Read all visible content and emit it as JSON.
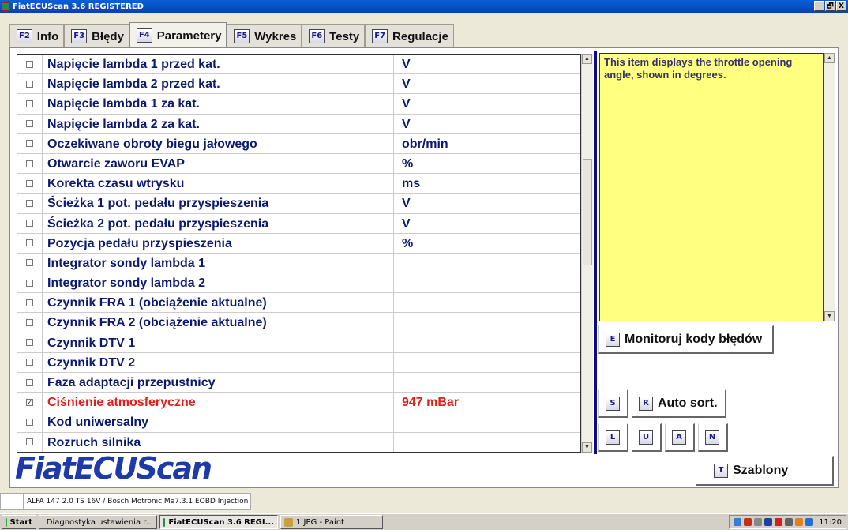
{
  "window": {
    "title": "FiatECUScan 3.6 REGISTERED",
    "controls": [
      "_",
      "🗗",
      "X"
    ]
  },
  "tabs": [
    {
      "key": "F2",
      "label": "Info"
    },
    {
      "key": "F3",
      "label": "Błędy"
    },
    {
      "key": "F4",
      "label": "Parametery",
      "active": true
    },
    {
      "key": "F5",
      "label": "Wykres"
    },
    {
      "key": "F6",
      "label": "Testy"
    },
    {
      "key": "F7",
      "label": "Regulacje"
    }
  ],
  "parameters": [
    {
      "name": "Napięcie lambda 1 przed kat.",
      "unit": "V",
      "checked": false
    },
    {
      "name": "Napięcie lambda 2 przed kat.",
      "unit": "V",
      "checked": false
    },
    {
      "name": "Napięcie lambda 1 za kat.",
      "unit": "V",
      "checked": false
    },
    {
      "name": "Napięcie lambda 2 za kat.",
      "unit": "V",
      "checked": false
    },
    {
      "name": "Oczekiwane obroty biegu jałowego",
      "unit": "obr/min",
      "checked": false
    },
    {
      "name": "Otwarcie zaworu EVAP",
      "unit": "%",
      "checked": false
    },
    {
      "name": "Korekta czasu wtrysku",
      "unit": "ms",
      "checked": false
    },
    {
      "name": "Ścieżka 1 pot. pedału przyspieszenia",
      "unit": "V",
      "checked": false
    },
    {
      "name": "Ścieżka 2 pot. pedału przyspieszenia",
      "unit": "V",
      "checked": false
    },
    {
      "name": "Pozycja pedału przyspieszenia",
      "unit": "%",
      "checked": false
    },
    {
      "name": "Integrator sondy lambda 1",
      "unit": "",
      "checked": false
    },
    {
      "name": "Integrator sondy lambda 2",
      "unit": "",
      "checked": false
    },
    {
      "name": "Czynnik FRA 1 (obciążenie aktualne)",
      "unit": "",
      "checked": false
    },
    {
      "name": "Czynnik FRA 2 (obciążenie aktualne)",
      "unit": "",
      "checked": false
    },
    {
      "name": "Czynnik DTV 1",
      "unit": "",
      "checked": false
    },
    {
      "name": "Czynnik DTV 2",
      "unit": "",
      "checked": false
    },
    {
      "name": "Faza adaptacji przepustnicy",
      "unit": "",
      "checked": false
    },
    {
      "name": "Ciśnienie atmosferyczne",
      "unit": "947 mBar",
      "checked": true,
      "selected": true
    },
    {
      "name": "Kod uniwersalny",
      "unit": "",
      "checked": false
    },
    {
      "name": "Rozruch silnika",
      "unit": "",
      "checked": false
    }
  ],
  "info_text": "This item displays the throttle opening angle, shown in degrees.",
  "buttons": {
    "monitor": {
      "key": "E",
      "label": "Monitoruj kody błędów"
    },
    "s": {
      "key": "S"
    },
    "autosort": {
      "key": "R",
      "label": "Auto sort."
    },
    "l": {
      "key": "L"
    },
    "u": {
      "key": "U"
    },
    "a": {
      "key": "A"
    },
    "n": {
      "key": "N"
    },
    "templates": {
      "key": "T",
      "label": "Szablony"
    }
  },
  "logo": "FiatECUScan",
  "status": {
    "vehicle": "ALFA 147 2.0 TS 16V / Bosch Motronic Me7.3.1 EOBD Injection"
  },
  "taskbar": {
    "start": "Start",
    "items": [
      {
        "label": "Diagnostyka ustawienia r...",
        "color": "#d01010"
      },
      {
        "label": "FiatECUScan 3.6 REGI...",
        "active": true,
        "color": "#2a8a4a"
      },
      {
        "label": "1.JPG - Paint",
        "color": "#c8a040"
      }
    ],
    "clock": "11:20"
  },
  "colors": {
    "accent": "#0c1a6e",
    "selected": "#e0201a",
    "info_bg": "#ffff80"
  }
}
